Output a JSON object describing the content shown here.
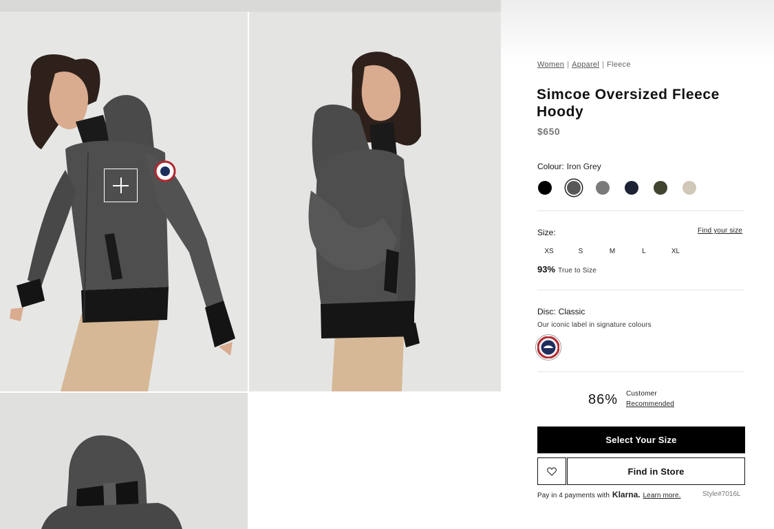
{
  "breadcrumb": {
    "items": [
      "Women",
      "Apparel",
      "Fleece"
    ],
    "separator": "|"
  },
  "product": {
    "title": "Simcoe Oversized Fleece Hoody",
    "price": "$650",
    "style": "Style#7016L"
  },
  "colour": {
    "label": "Colour:",
    "selected": "Iron Grey",
    "swatches": [
      {
        "name": "Black",
        "hex": "#000000",
        "selected": false
      },
      {
        "name": "Iron Grey",
        "hex": "#585858",
        "selected": true
      },
      {
        "name": "Grey",
        "hex": "#7b7b7b",
        "selected": false
      },
      {
        "name": "Navy",
        "hex": "#1d2235",
        "selected": false
      },
      {
        "name": "Olive",
        "hex": "#41442f",
        "selected": false
      },
      {
        "name": "Sand",
        "hex": "#cfc7b8",
        "selected": false
      }
    ]
  },
  "size": {
    "label": "Size:",
    "find_size": "Find your size",
    "options": [
      "XS",
      "S",
      "M",
      "L",
      "XL"
    ],
    "true_to_size_pct": "93%",
    "true_to_size_label": "True to Size"
  },
  "disc": {
    "label": "Disc:",
    "selected": "Classic",
    "description": "Our iconic label in signature colours"
  },
  "recommendation": {
    "percent": "86%",
    "line1": "Customer",
    "line2": "Recommended"
  },
  "actions": {
    "select_size": "Select Your Size",
    "find_in_store": "Find in Store",
    "wishlist_icon": "heart-icon"
  },
  "payment": {
    "prefix": "Pay in 4 payments with",
    "provider": "Klarna.",
    "learn_more": "Learn more."
  },
  "gallery": {
    "zoom_icon": "plus-icon",
    "colors": {
      "fleece": "#4e4e4e",
      "rib": "#141414",
      "pants": "#d6b896",
      "skin": "#d9ab8f",
      "hair": "#2e211b"
    }
  }
}
